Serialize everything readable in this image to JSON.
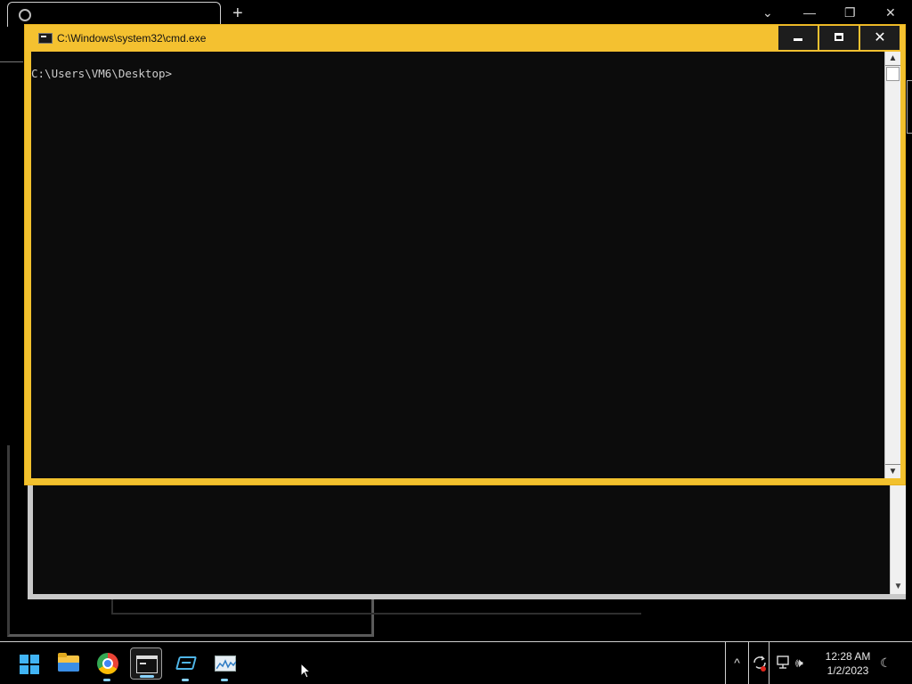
{
  "background_browser": {
    "new_tab_label": "+",
    "controls": {
      "dropdown": "⌄",
      "minimize": "—",
      "restore": "❐",
      "close": "✕"
    }
  },
  "cmd_window": {
    "title": "C:\\Windows\\system32\\cmd.exe",
    "buttons": {
      "minimize_label": "",
      "maximize_label": "",
      "close_label": "✕"
    },
    "console_lines": [
      "C:\\Users\\VM6\\Desktop>"
    ],
    "scroll_up": "▲",
    "scroll_down": "▼"
  },
  "background_cmd_window": {
    "scroll_down": "▼"
  },
  "taskbar": {
    "items": [
      {
        "name": "Start",
        "icon": "windows-logo-icon"
      },
      {
        "name": "File Explorer",
        "icon": "folder-icon"
      },
      {
        "name": "Google Chrome",
        "icon": "chrome-icon"
      },
      {
        "name": "Command Prompt",
        "icon": "terminal-icon",
        "active": true
      },
      {
        "name": "App",
        "icon": "box-icon"
      },
      {
        "name": "Performance Monitor",
        "icon": "monitor-icon"
      }
    ],
    "tray": {
      "chevron": "^",
      "volume": "🕪",
      "time": "12:28 AM",
      "date": "1/2/2023",
      "focus_icon": "☾"
    }
  },
  "colors": {
    "cmd_frame": "#f2c12e",
    "console_bg": "#0c0c0c",
    "console_text": "#cccccc",
    "taskbar_bg": "#000000",
    "accent": "#41b4f5"
  }
}
